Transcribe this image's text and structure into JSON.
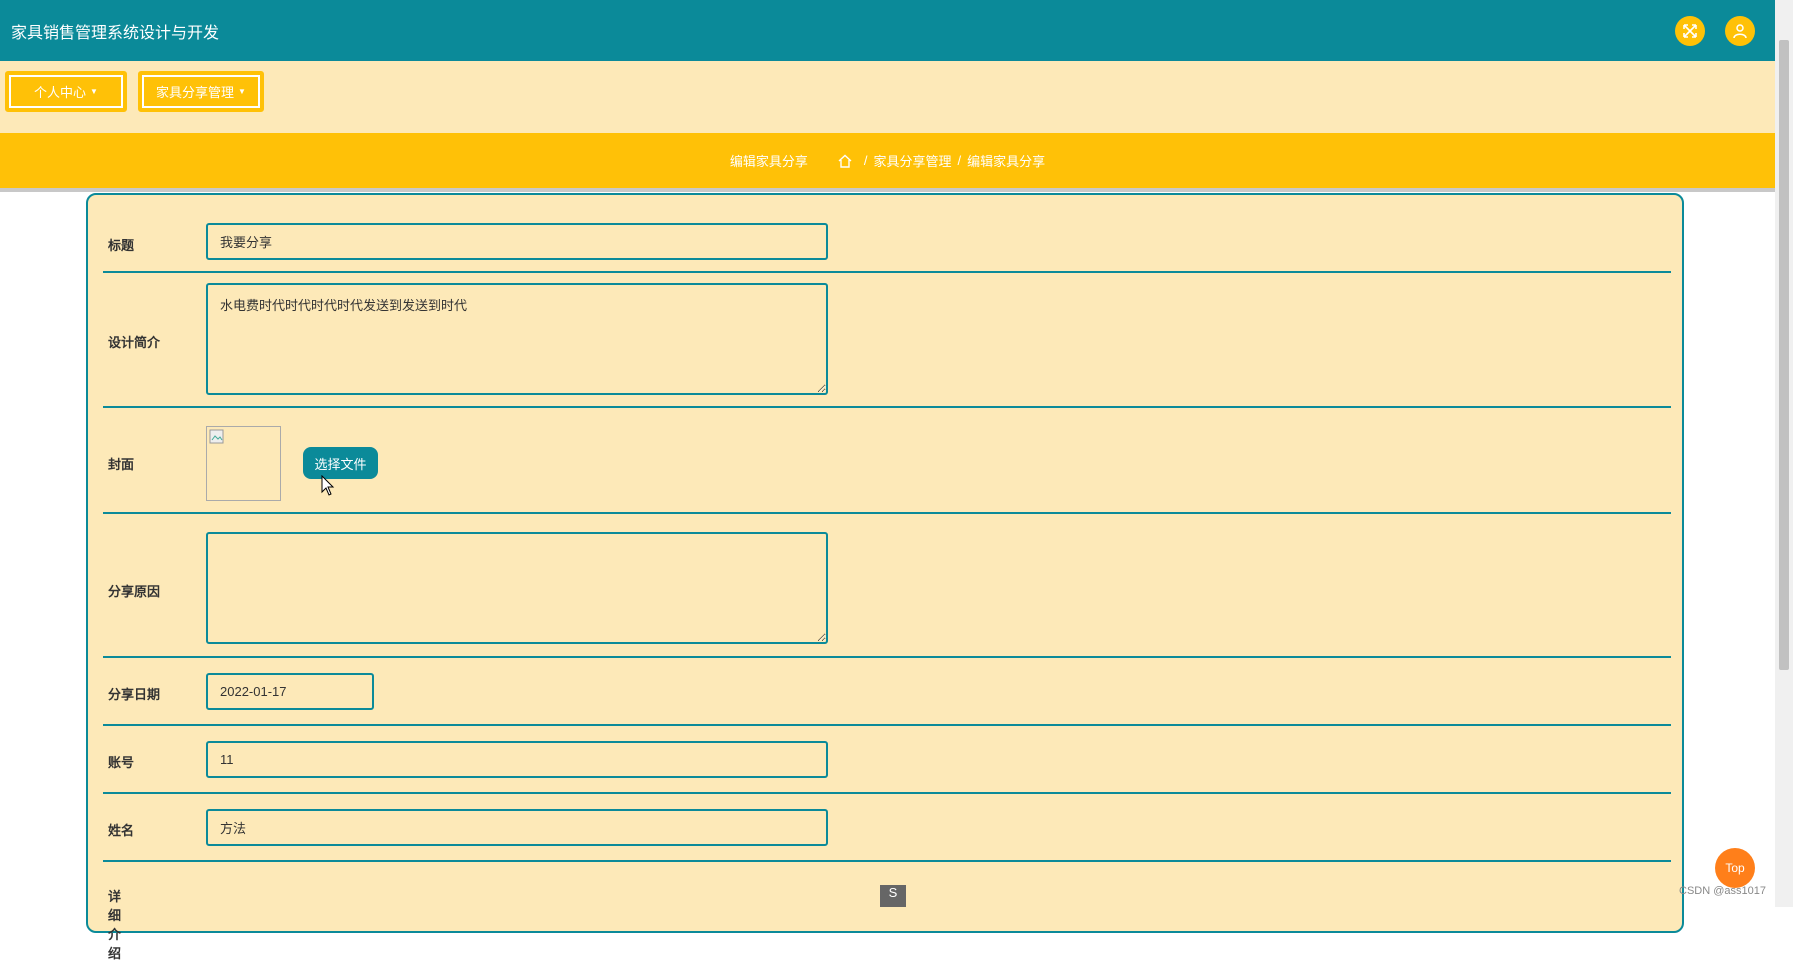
{
  "app": {
    "title": "家具销售管理系统设计与开发"
  },
  "header_icons": [
    "fullscreen-icon",
    "user-icon"
  ],
  "menu": [
    {
      "label": "个人中心"
    },
    {
      "label": "家具分享管理"
    }
  ],
  "breadcrumb": {
    "page_title": "编辑家具分享",
    "items": [
      "家具分享管理",
      "编辑家具分享"
    ],
    "separator": "/"
  },
  "form": {
    "title_label": "标题",
    "title_value": "我要分享",
    "intro_label": "设计简介",
    "intro_value": "水电费时代时代时代时代发送到发送到时代",
    "cover_label": "封面",
    "cover_button": "选择文件",
    "reason_label": "分享原因",
    "reason_value": "",
    "date_label": "分享日期",
    "date_value": "2022-01-17",
    "account_label": "账号",
    "account_value": "11",
    "name_label": "姓名",
    "name_value": "方法",
    "detail_label": "详细介绍"
  },
  "floating": {
    "top_button": "Top",
    "watermark": "CSDN @ass1017",
    "mini_label": "S"
  },
  "colors": {
    "primary": "#0b8a99",
    "accent": "#ffc107",
    "panel": "#fde9b8",
    "top_button": "#ff7f1a"
  }
}
